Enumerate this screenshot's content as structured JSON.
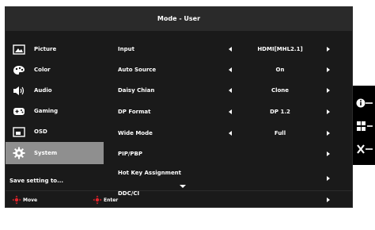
{
  "title": "Mode - User",
  "sidebar": {
    "items": [
      {
        "label": "Picture",
        "icon": "picture-icon"
      },
      {
        "label": "Color",
        "icon": "palette-icon"
      },
      {
        "label": "Audio",
        "icon": "speaker-icon"
      },
      {
        "label": "Gaming",
        "icon": "gamepad-icon"
      },
      {
        "label": "OSD",
        "icon": "osd-icon"
      },
      {
        "label": "System",
        "icon": "gear-icon",
        "selected": true
      }
    ],
    "save_label": "Save setting to..."
  },
  "settings": {
    "rows": [
      {
        "label": "Input",
        "value": "HDMI[MHL2.1]",
        "has_left": true
      },
      {
        "label": "Auto Source",
        "value": "On",
        "has_left": true
      },
      {
        "label": "Daisy Chian",
        "value": "Clone",
        "has_left": true
      },
      {
        "label": "DP Format",
        "value": "DP 1.2",
        "has_left": true
      },
      {
        "label": "Wide Mode",
        "value": "Full",
        "has_left": true
      },
      {
        "label": "PIP/PBP",
        "value": "",
        "has_left": false
      },
      {
        "label": "Hot Key Assignment",
        "value": "",
        "has_left": false
      },
      {
        "label": "DDC/CI",
        "value": "",
        "has_left": false
      }
    ]
  },
  "footer": {
    "move_label": "Move",
    "enter_label": "Enter"
  },
  "side_buttons": [
    "info-icon",
    "grid-icon",
    "close-icon"
  ],
  "colors": {
    "panel_bg": "#1a1a1a",
    "title_bg": "#2a2a2a",
    "selected_bg": "#8f8f8f",
    "accent_red": "#e8232a"
  }
}
